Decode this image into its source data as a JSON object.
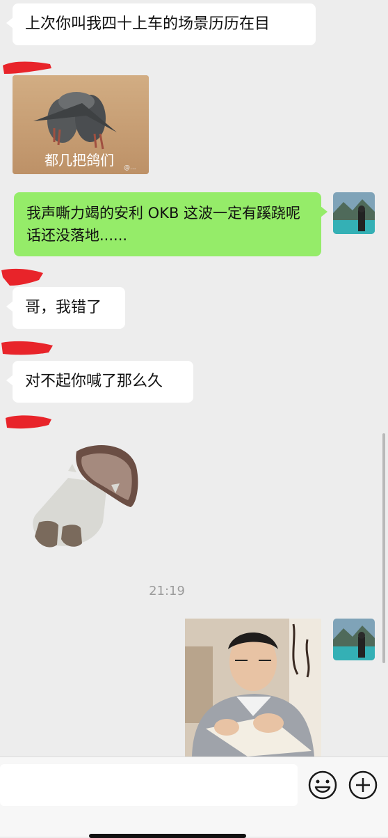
{
  "messages": {
    "m1_text": "上次你叫我四十上车的场景历历在目",
    "m2_sticker_caption": "都几把鸽们",
    "m2_watermark": "@...",
    "m3_text": "我声嘶力竭的安利 OKB 这波一定有蹊跷呢话还没落地......",
    "m4_text": "哥，我错了",
    "m5_text": "对不起你喊了那么久",
    "timestamp": "21:19"
  },
  "input": {
    "placeholder": ""
  },
  "colors": {
    "background": "#ededed",
    "incoming_bubble": "#ffffff",
    "outgoing_bubble": "#95ec69",
    "redaction": "#e8242a"
  },
  "icons": [
    "emoji-icon",
    "plus-icon"
  ]
}
